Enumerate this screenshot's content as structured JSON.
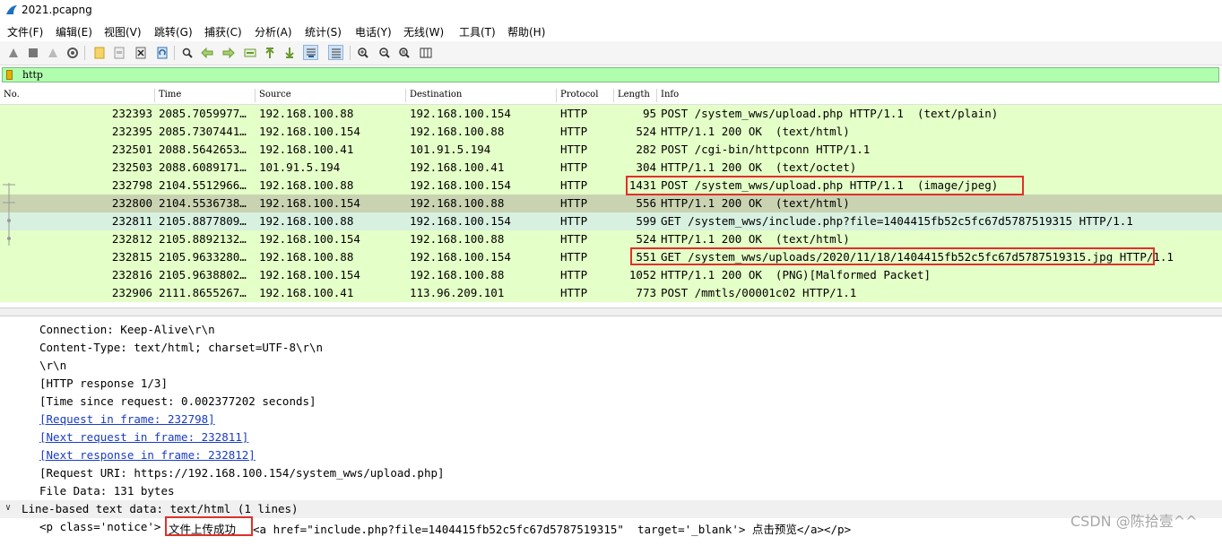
{
  "window": {
    "title": "2021.pcapng"
  },
  "menu": [
    "文件(F)",
    "编辑(E)",
    "视图(V)",
    "跳转(G)",
    "捕获(C)",
    "分析(A)",
    "统计(S)",
    "电话(Y)",
    "无线(W)",
    "工具(T)",
    "帮助(H)"
  ],
  "filter": {
    "value": "http"
  },
  "columns": [
    "No.",
    "Time",
    "Source",
    "Destination",
    "Protocol",
    "Length",
    "Info"
  ],
  "packets": [
    {
      "no": "232393",
      "time": "2085.7059977…",
      "src": "192.168.100.88",
      "dst": "192.168.100.154",
      "proto": "HTTP",
      "len": "95",
      "info": "POST /system_wws/upload.php HTTP/1.1  (text/plain)"
    },
    {
      "no": "232395",
      "time": "2085.7307441…",
      "src": "192.168.100.154",
      "dst": "192.168.100.88",
      "proto": "HTTP",
      "len": "524",
      "info": "HTTP/1.1 200 OK  (text/html)"
    },
    {
      "no": "232501",
      "time": "2088.5642653…",
      "src": "192.168.100.41",
      "dst": "101.91.5.194",
      "proto": "HTTP",
      "len": "282",
      "info": "POST /cgi-bin/httpconn HTTP/1.1"
    },
    {
      "no": "232503",
      "time": "2088.6089171…",
      "src": "101.91.5.194",
      "dst": "192.168.100.41",
      "proto": "HTTP",
      "len": "304",
      "info": "HTTP/1.1 200 OK  (text/octet)"
    },
    {
      "no": "232798",
      "time": "2104.5512966…",
      "src": "192.168.100.88",
      "dst": "192.168.100.154",
      "proto": "HTTP",
      "len": "1431",
      "info": "POST /system_wws/upload.php HTTP/1.1  (image/jpeg)"
    },
    {
      "no": "232800",
      "time": "2104.5536738…",
      "src": "192.168.100.154",
      "dst": "192.168.100.88",
      "proto": "HTTP",
      "len": "556",
      "info": "HTTP/1.1 200 OK  (text/html)"
    },
    {
      "no": "232811",
      "time": "2105.8877809…",
      "src": "192.168.100.88",
      "dst": "192.168.100.154",
      "proto": "HTTP",
      "len": "599",
      "info": "GET /system_wws/include.php?file=1404415fb52c5fc67d5787519315 HTTP/1.1"
    },
    {
      "no": "232812",
      "time": "2105.8892132…",
      "src": "192.168.100.154",
      "dst": "192.168.100.88",
      "proto": "HTTP",
      "len": "524",
      "info": "HTTP/1.1 200 OK  (text/html)"
    },
    {
      "no": "232815",
      "time": "2105.9633280…",
      "src": "192.168.100.88",
      "dst": "192.168.100.154",
      "proto": "HTTP",
      "len": "551",
      "info": "GET /system_wws/uploads/2020/11/18/1404415fb52c5fc67d5787519315.jpg HTTP/1.1"
    },
    {
      "no": "232816",
      "time": "2105.9638802…",
      "src": "192.168.100.154",
      "dst": "192.168.100.88",
      "proto": "HTTP",
      "len": "1052",
      "info": "HTTP/1.1 200 OK  (PNG)[Malformed Packet]"
    },
    {
      "no": "232906",
      "time": "2111.8655267…",
      "src": "192.168.100.41",
      "dst": "113.96.209.101",
      "proto": "HTTP",
      "len": "773",
      "info": "POST /mmtls/00001c02 HTTP/1.1"
    }
  ],
  "details": {
    "lines": [
      "Connection: Keep-Alive\\r\\n",
      "Content-Type: text/html; charset=UTF-8\\r\\n",
      "\\r\\n",
      "[HTTP response 1/3]",
      "[Time since request: 0.002377202 seconds]",
      "[Request in frame: 232798]",
      "[Next request in frame: 232811]",
      "[Next response in frame: 232812]",
      "[Request URI: https://192.168.100.154/system_wws/upload.php]",
      "File Data: 131 bytes"
    ],
    "section": "Line-based text data: text/html (1 lines)",
    "body_prefix": "<p class='notice'>",
    "body_highlight": "文件上传成功",
    "body_suffix": "<a href=\"include.php?file=1404415fb52c5fc67d5787519315\"  target='_blank'> 点击预览</a></p>"
  },
  "watermark": "CSDN @陈拾壹^^"
}
